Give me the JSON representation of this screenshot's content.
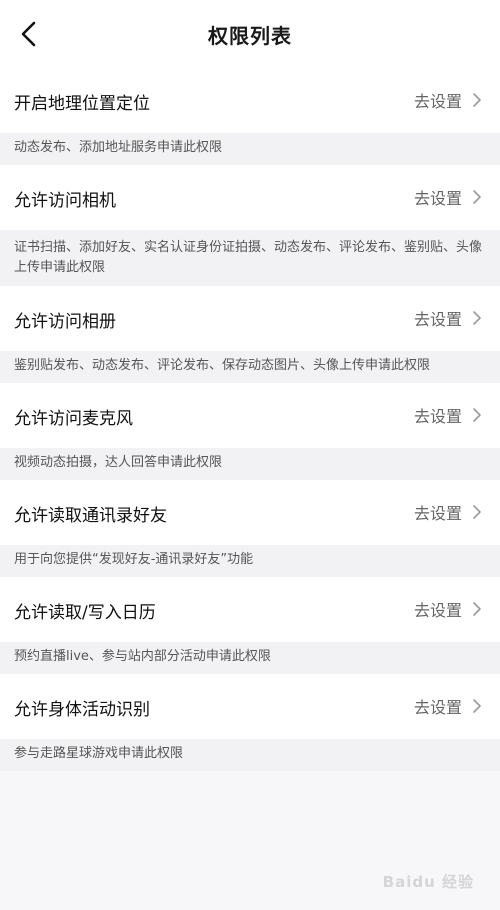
{
  "header": {
    "title": "权限列表"
  },
  "permissions": [
    {
      "label": "开启地理位置定位",
      "action": "去设置",
      "description": "动态发布、添加地址服务申请此权限"
    },
    {
      "label": "允许访问相机",
      "action": "去设置",
      "description": "证书扫描、添加好友、实名认证身份证拍摄、动态发布、评论发布、鉴别贴、头像上传申请此权限"
    },
    {
      "label": "允许访问相册",
      "action": "去设置",
      "description": "鉴别贴发布、动态发布、评论发布、保存动态图片、头像上传申请此权限"
    },
    {
      "label": "允许访问麦克风",
      "action": "去设置",
      "description": "视频动态拍摄，达人回答申请此权限"
    },
    {
      "label": "允许读取通讯录好友",
      "action": "去设置",
      "description": "用于向您提供“发现好友-通讯录好友”功能"
    },
    {
      "label": "允许读取/写入日历",
      "action": "去设置",
      "description": "预约直播live、参与站内部分活动申请此权限"
    },
    {
      "label": "允许身体活动识别",
      "action": "去设置",
      "description": "参与走路星球游戏申请此权限"
    }
  ],
  "watermark": "Baidu 经验",
  "icons": {
    "back": "back-arrow-icon",
    "chevron": "chevron-right-icon"
  }
}
